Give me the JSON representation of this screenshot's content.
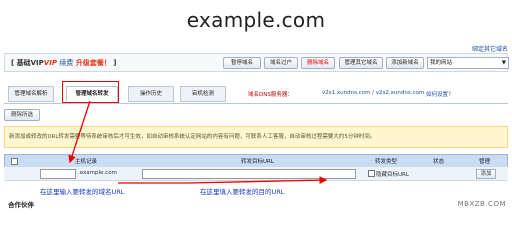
{
  "header": {
    "domain": "example.com",
    "bind_other_domain": "绑定其它域名"
  },
  "account": {
    "plan": "基础VIP",
    "badge": "VIP",
    "renew": "续费",
    "upgrade": "升级套餐！"
  },
  "toolbar": {
    "buttons": [
      "暂停域名",
      "域名过户",
      "删除域名",
      "管理其它域名",
      "添加新域名"
    ],
    "select_value": "我的网站"
  },
  "tabs": [
    "管理域名解析",
    "管理域名转发",
    "操作历史",
    "宕机检测"
  ],
  "dns": {
    "label": "域名DNS服务器：",
    "servers": "v2s1.xundns.com / v2s2.xundns.com",
    "howto": "如何设置？"
  },
  "actions": {
    "delete_selected": "删除所选"
  },
  "notice": "新添加或修改的URL转发需要等待系统审核后才可生效，如自动审核系统认定网站的内容有问题，可联系人工客服，自动审核过程需要大约5分钟时间。",
  "table": {
    "headers": [
      "主机记录",
      "转发目标URL",
      "转发类型",
      "状态",
      "管理"
    ],
    "row": {
      "host_suffix": ".example.com",
      "hide_target": "隐藏目标URL",
      "add": "添加"
    }
  },
  "annotations": {
    "host": "在这里输入要转发的域名URL",
    "target": "在这里填入要转发的目的URL"
  },
  "footer": {
    "partners": "合作伙伴",
    "watermark": "MBXZB.COM"
  },
  "colors": {
    "accent": "#1a4fa3",
    "highlight": "#e00000",
    "annotation": "#1637c9"
  }
}
